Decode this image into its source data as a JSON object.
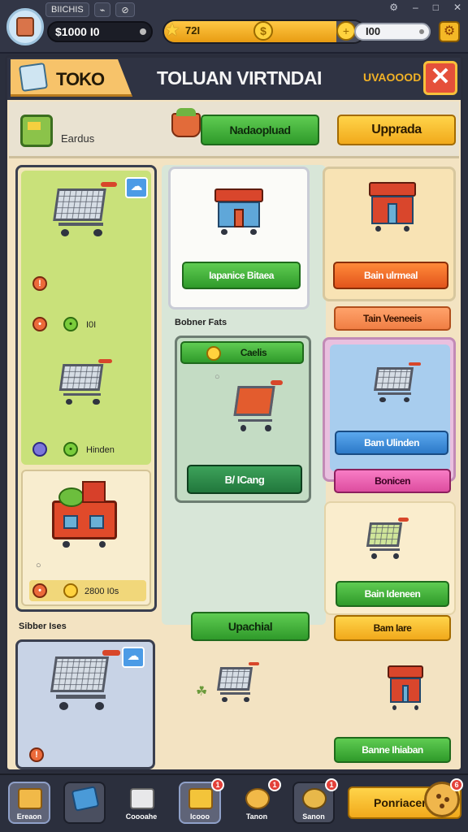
{
  "topbar": {
    "chip1": "BIICHIS",
    "coins": "$1000 I0",
    "xp": "72I",
    "gems": "I00"
  },
  "header": {
    "tab_label": "TOKO",
    "title": "TOLUAN VIRTNDAI",
    "sublabel": "UVAOOOD"
  },
  "subbar": {
    "label": "Eardus",
    "green_btn": "Nadaopluad",
    "yellow_btn": "Upprada"
  },
  "left": {
    "row1_value": "I0I",
    "row2_label": "Hinden",
    "row3_value": "2800 I0s"
  },
  "center": {
    "card1_btn": "Iapanice Bitaea",
    "section_label": "Bobner Fats",
    "card2_header": "Caelis",
    "card2_btn": "B/ ICang",
    "bottom_btn": "Upachial"
  },
  "right": {
    "card1_btn": "Bain ulrmeal",
    "card1_sub": "Tain Veeneeis",
    "card2_btn": "Bam Ulinden",
    "card2_sub": "Bonicen",
    "card3_btn": "Bain Ideneen",
    "card3_sub": "Bam Iare",
    "card4_btn": "Banne Ihiaban"
  },
  "bottom_section_label": "Sibber Ises",
  "nav": {
    "items": [
      {
        "label": "Ereaon",
        "badge": ""
      },
      {
        "label": "",
        "badge": ""
      },
      {
        "label": "Coooahe",
        "badge": ""
      },
      {
        "label": "Icooo",
        "badge": "1"
      },
      {
        "label": "Tanon",
        "badge": "1"
      },
      {
        "label": "Sanon",
        "badge": "1"
      }
    ],
    "big_btn": "Ponriacer",
    "big_badge": "6"
  },
  "colors": {
    "accent_yellow": "#f1a91b",
    "accent_green": "#2f9a2a",
    "panel_bg": "#f3e3c2",
    "close_red": "#e5503a"
  },
  "xp_progress": 0.86
}
